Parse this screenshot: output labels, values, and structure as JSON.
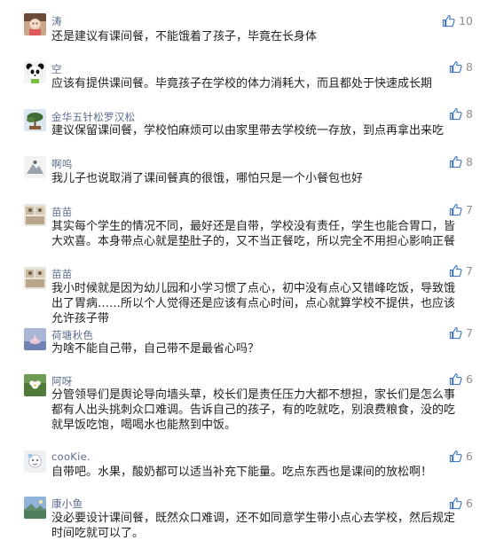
{
  "colors": {
    "nickname": "#5b6b8c",
    "comment_text": "#1f1f1f",
    "like_icon": "#2f6cc2",
    "like_count": "#8e8e8e",
    "background": "#ffffff"
  },
  "comments": [
    {
      "nickname": "涛",
      "text": "还是建议有课间餐，不能饿着了孩子，毕竟在长身体",
      "likes": "10",
      "like_icon": "thumbs-up-icon",
      "avatar": "avatar-doll-icon"
    },
    {
      "nickname": "空",
      "text": "应该有提供课间餐。毕竟孩子在学校的体力消耗大，而且都处于快速成长期",
      "likes": "8",
      "like_icon": "thumbs-up-icon",
      "avatar": "avatar-panda-icon"
    },
    {
      "nickname": "金华五针松罗汉松",
      "text": "建议保留课间餐，学校怕麻烦可以由家里带去学校统一存放，到点再拿出来吃",
      "likes": "8",
      "like_icon": "thumbs-up-icon",
      "avatar": "avatar-bonsai-icon"
    },
    {
      "nickname": "啊呜",
      "text": "我儿子也说取消了课间餐真的很饿，哪怕只是一个小餐包也好",
      "likes": "8",
      "like_icon": "thumbs-up-icon",
      "avatar": "avatar-mountain-icon"
    },
    {
      "nickname": "苗苗",
      "text": "其实每个学生的情况不同，最好还是自带，学校没有责任，学生也能合胃口，皆大欢喜。本身带点心就是垫肚子的，又不当正餐吃，所以完全不用担心影响正餐",
      "likes": "7",
      "like_icon": "thumbs-up-icon",
      "avatar": "avatar-photo-icon"
    },
    {
      "nickname": "苗苗",
      "text": "我小时候就是因为幼儿园和小学习惯了点心，初中没有点心又错峰吃饭，导致饿出了胃病……所以个人觉得还是应该有点心时间，点心就算学校不提供，也应该允许孩子带",
      "likes": "7",
      "like_icon": "thumbs-up-icon",
      "avatar": "avatar-photo-icon"
    },
    {
      "nickname": "荷塘秋色",
      "text": "为啥不能自己带，自己带不是最省心吗？",
      "likes": "7",
      "like_icon": "thumbs-up-icon",
      "avatar": "avatar-lotus-icon"
    },
    {
      "nickname": "阿呀",
      "text": "分管领导们是舆论导向墙头草，校长们是责任压力大都不想担，家长们是怎么事都有人出头挑刺众口难调。告诉自己的孩子，有的吃就吃，别浪费粮食，没的吃就早饭吃饱，喝喝水也能熬到中饭。",
      "likes": "6",
      "like_icon": "thumbs-up-icon",
      "avatar": "avatar-flower-icon"
    },
    {
      "nickname": "cooKie.",
      "text": "自带吧。水果，酸奶都可以适当补充下能量。吃点东西也是课间的放松啊！",
      "likes": "6",
      "like_icon": "thumbs-up-icon",
      "avatar": "avatar-cartoon-icon"
    },
    {
      "nickname": "康小鱼",
      "text": "没必要设计课间餐，既然众口难调，还不如同意学生带小点心去学校，然后规定时间吃就可以了。",
      "likes": "6",
      "like_icon": "thumbs-up-icon",
      "avatar": "avatar-landscape-icon"
    }
  ]
}
